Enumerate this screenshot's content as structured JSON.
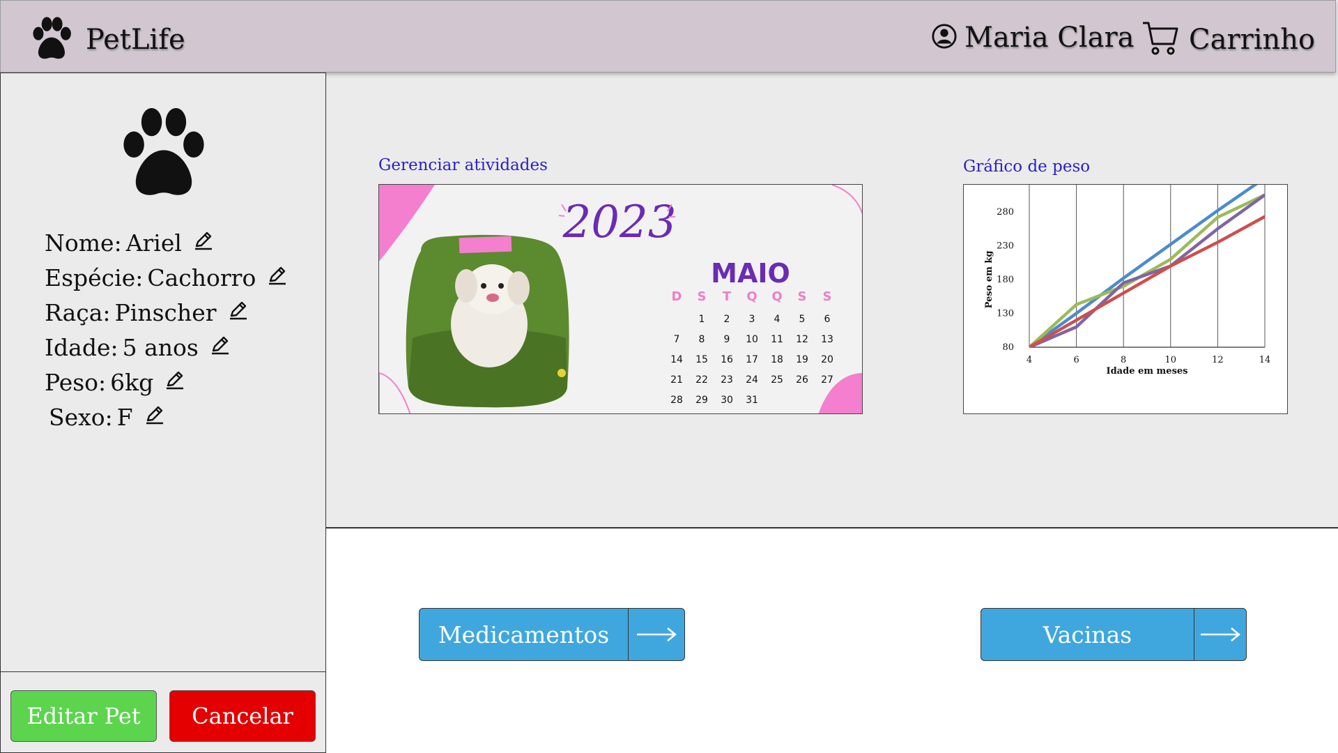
{
  "header": {
    "brand": "PetLife",
    "user_name": "Maria Clara",
    "cart_label": "Carrinho"
  },
  "sidebar": {
    "fields": [
      {
        "label": "Nome:",
        "value": "Ariel"
      },
      {
        "label": "Espécie:",
        "value": "Cachorro"
      },
      {
        "label": "Raça:",
        "value": "Pinscher"
      },
      {
        "label": "Idade:",
        "value": "5 anos"
      },
      {
        "label": "Peso:",
        "value": "6kg"
      },
      {
        "label": "Sexo:",
        "value": "F"
      }
    ],
    "edit_button": "Editar Pet",
    "cancel_button": "Cancelar"
  },
  "activities": {
    "title": "Gerenciar atividades",
    "calendar": {
      "year": "2023",
      "month": "MAIO",
      "weekdays": [
        "D",
        "S",
        "T",
        "Q",
        "Q",
        "S",
        "S"
      ],
      "weeks": [
        [
          "",
          "1",
          "2",
          "3",
          "4",
          "5",
          "6"
        ],
        [
          "7",
          "8",
          "9",
          "10",
          "11",
          "12",
          "13"
        ],
        [
          "14",
          "15",
          "16",
          "17",
          "18",
          "19",
          "20"
        ],
        [
          "21",
          "22",
          "23",
          "24",
          "25",
          "26",
          "27"
        ],
        [
          "28",
          "29",
          "30",
          "31",
          "",
          "",
          ""
        ]
      ]
    }
  },
  "weight_chart": {
    "title": "Gráfico de peso"
  },
  "chart_data": {
    "type": "line",
    "xlabel": "Idade em meses",
    "ylabel": "Peso em kg",
    "xlim": [
      4,
      14
    ],
    "ylim": [
      80,
      320
    ],
    "xticks": [
      4,
      6,
      8,
      10,
      12,
      14
    ],
    "yticks": [
      80,
      130,
      180,
      230,
      280
    ],
    "grid": "vertical",
    "x": [
      4,
      6,
      8,
      10,
      12,
      14
    ],
    "series": [
      {
        "color": "#4a8ccc",
        "values": [
          80,
          130,
          182,
          232,
          282,
          330
        ]
      },
      {
        "color": "#9bbb59",
        "values": [
          80,
          143,
          170,
          210,
          272,
          305
        ]
      },
      {
        "color": "#8064a2",
        "values": [
          80,
          110,
          175,
          200,
          255,
          305
        ]
      },
      {
        "color": "#cd4f4d",
        "values": [
          80,
          120,
          160,
          200,
          235,
          273
        ]
      }
    ]
  },
  "actions": {
    "medicamentos": "Medicamentos",
    "vacinas": "Vacinas"
  }
}
